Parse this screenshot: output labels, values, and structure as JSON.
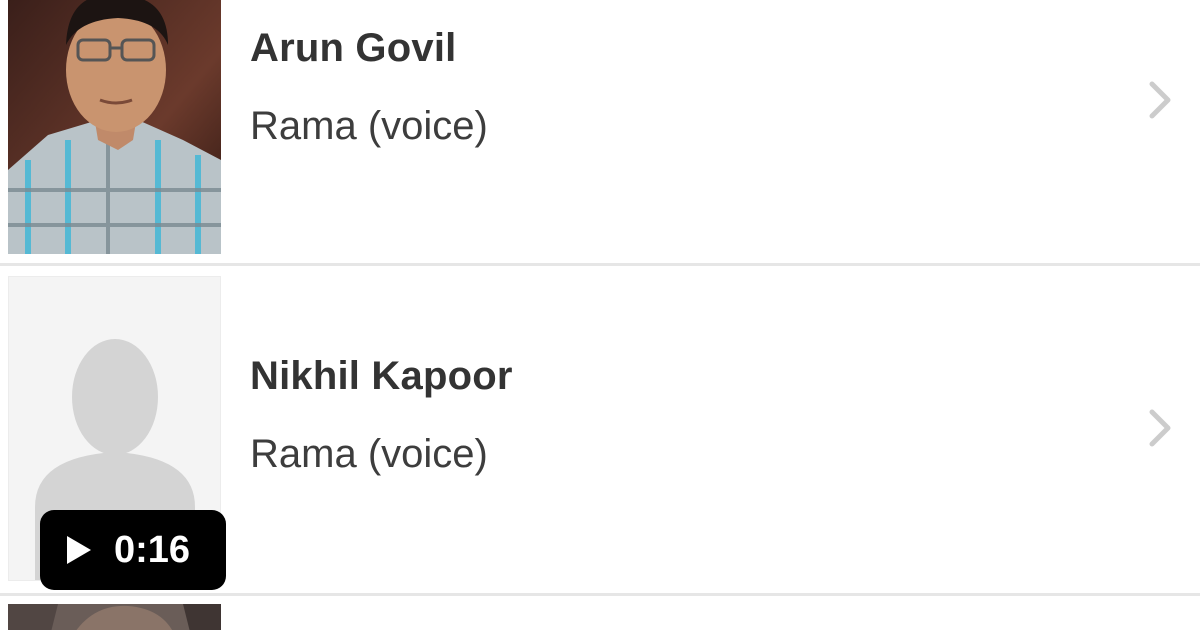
{
  "cast": [
    {
      "name": "Arun Govil",
      "role": "Rama (voice)",
      "photo": "actor-photo"
    },
    {
      "name": "Nikhil Kapoor",
      "role": "Rama (voice)",
      "photo": "placeholder-person-icon"
    },
    {
      "photo": "actor-photo-partial"
    }
  ],
  "video_badge": {
    "duration": "0:16",
    "icon": "play-icon"
  },
  "colors": {
    "name_text": "#333333",
    "role_text": "#3d3d3d",
    "divider": "#e6e6e6",
    "chevron": "#cccccc",
    "badge_bg": "#000000",
    "placeholder": "#d4d4d4"
  }
}
